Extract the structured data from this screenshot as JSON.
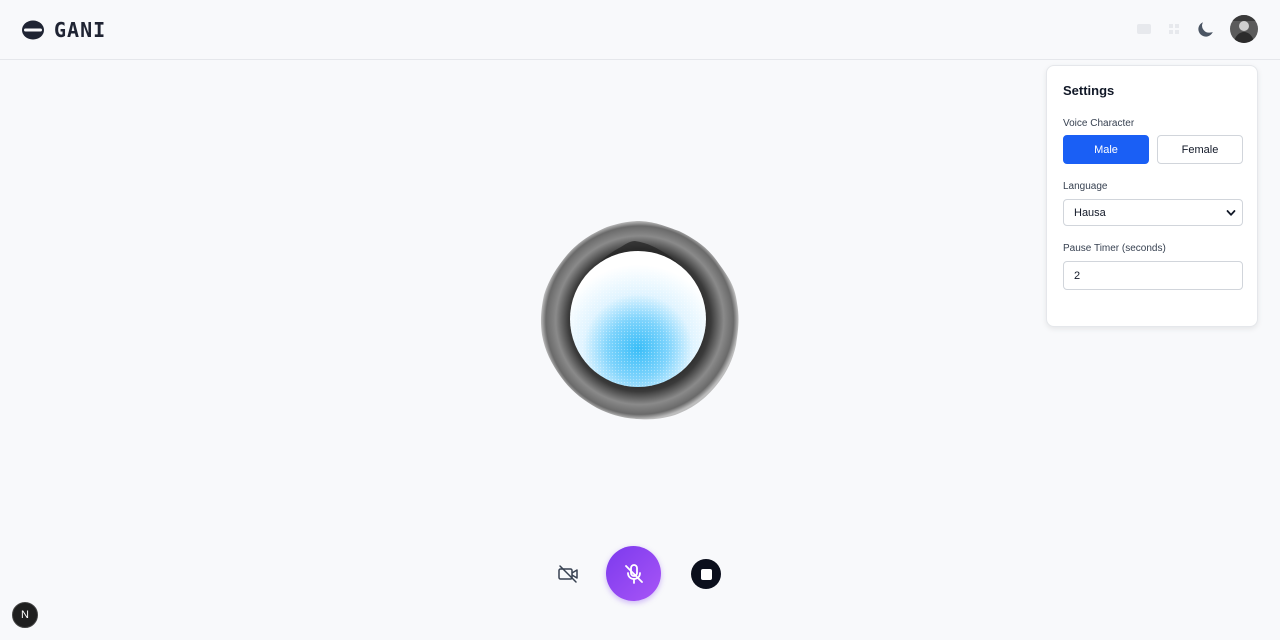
{
  "app": {
    "title": "GANI"
  },
  "header": {
    "icons": [
      "logo-icon",
      "chat-icon",
      "grid-icon",
      "moon-icon",
      "avatar"
    ]
  },
  "settings": {
    "title": "Settings",
    "voice_label": "Voice Character",
    "voice_options": [
      "Male",
      "Female"
    ],
    "voice_selected": "Male",
    "language_label": "Language",
    "language_value": "Hausa",
    "pause_label": "Pause Timer (seconds)",
    "pause_value": "2"
  },
  "controls": {
    "icons": [
      "camera-off-icon",
      "mic-off-icon",
      "stop-icon"
    ]
  },
  "badge": {
    "text": "N"
  },
  "colors": {
    "accent_blue": "#1a5ff5",
    "mic_purple": "#7c3aed",
    "stop_dark": "#0b0f1c",
    "orb_blue": "#38bdf8"
  }
}
